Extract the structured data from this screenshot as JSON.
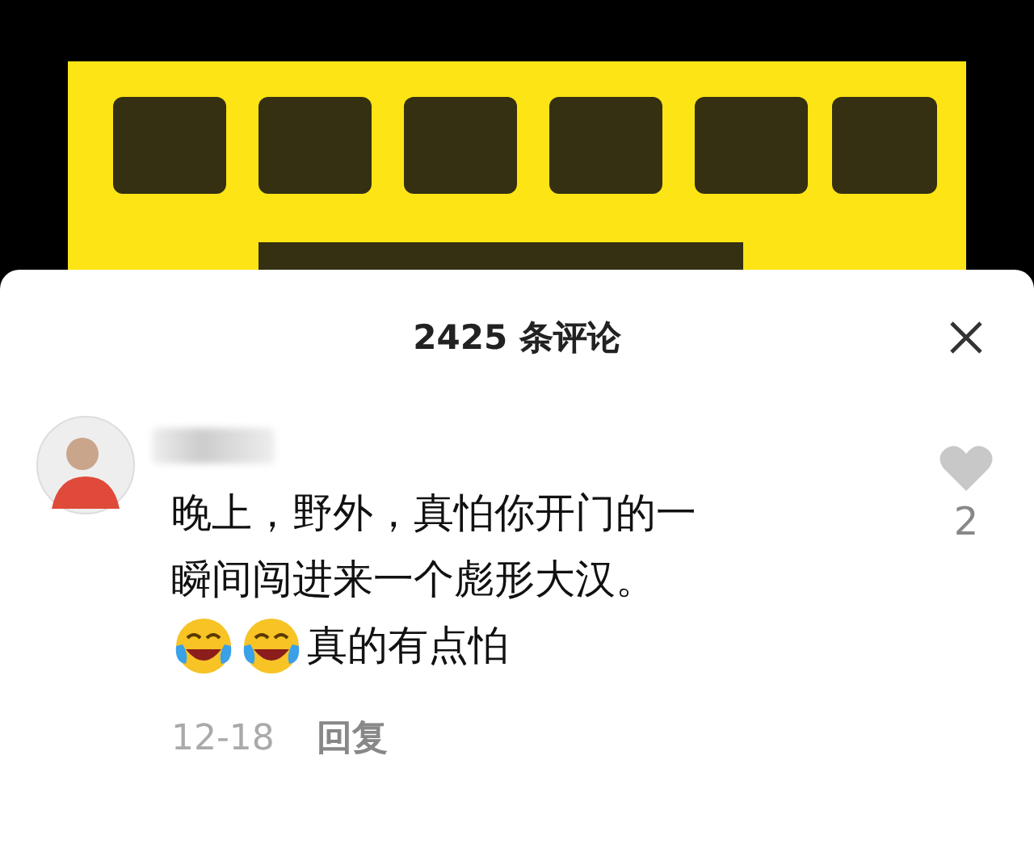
{
  "comments_panel": {
    "title": "2425 条评论",
    "comments": [
      {
        "lines": [
          "晚上，野外，真怕你开门的一",
          "瞬间闯进来一个彪形大汉。"
        ],
        "emoji_line": "真的有点怕",
        "date": "12-18",
        "reply": "回复",
        "likes": "2",
        "liked": false
      }
    ]
  }
}
